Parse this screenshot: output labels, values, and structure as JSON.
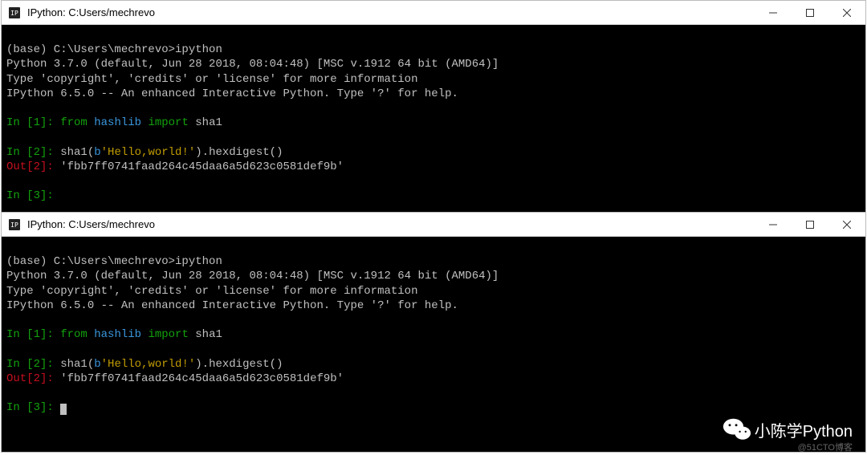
{
  "window1": {
    "title": "IPython: C:Users/mechrevo",
    "shell_prompt": "(base) C:\\Users\\mechrevo>ipython",
    "version_line": "Python 3.7.0 (default, Jun 28 2018, 08:04:48) [MSC v.1912 64 bit (AMD64)]",
    "info_line": "Type 'copyright', 'credits' or 'license' for more information",
    "ipython_line": "IPython 6.5.0 -- An enhanced Interactive Python. Type '?' for help.",
    "in1_prefix": "In [1]:",
    "in1_kw_from": "from",
    "in1_mod": "hashlib",
    "in1_kw_import": "import",
    "in1_name": "sha1",
    "in2_prefix": "In [2]:",
    "in2_call1": "sha1(",
    "in2_bytesprefix": "b",
    "in2_str": "'Hello,world!'",
    "in2_call2": ").hexdigest()",
    "out2_prefix": "Out[2]:",
    "out2_value": "'fbb7ff0741faad264c45daa6a5d623c0581def9b'",
    "in3_prefix": "In [3]:"
  },
  "window2": {
    "title": "IPython: C:Users/mechrevo",
    "shell_prompt": "(base) C:\\Users\\mechrevo>ipython",
    "version_line": "Python 3.7.0 (default, Jun 28 2018, 08:04:48) [MSC v.1912 64 bit (AMD64)]",
    "info_line": "Type 'copyright', 'credits' or 'license' for more information",
    "ipython_line": "IPython 6.5.0 -- An enhanced Interactive Python. Type '?' for help.",
    "in1_prefix": "In [1]:",
    "in1_kw_from": "from",
    "in1_mod": "hashlib",
    "in1_kw_import": "import",
    "in1_name": "sha1",
    "in2_prefix": "In [2]:",
    "in2_call1": "sha1(",
    "in2_bytesprefix": "b",
    "in2_str": "'Hello,world!'",
    "in2_call2": ").hexdigest()",
    "out2_prefix": "Out[2]:",
    "out2_value": "'fbb7ff0741faad264c45daa6a5d623c0581def9b'",
    "in3_prefix": "In [3]:"
  },
  "watermark": {
    "text": "小陈学Python",
    "sub": "@51CTO博客"
  }
}
